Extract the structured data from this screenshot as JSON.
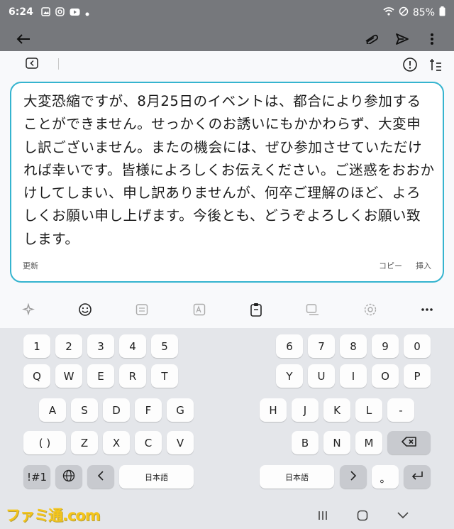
{
  "status": {
    "time": "6:24",
    "battery": "85%"
  },
  "compose": {
    "text": "大変恐縮ですが、8月25日のイベントは、都合により参加することができません。せっかくのお誘いにもかかわらず、大変申し訳ございません。またの機会には、ぜひ参加させていただければ幸いです。皆様によろしくお伝えください。ご迷惑をおおかけしてしまい、申し訳ありませんが、何卒ご理解のほど、よろしくお願い申し上げます。今後とも、どうぞよろしくお願い致します。",
    "refresh_label": "更新",
    "copy_label": "コピー",
    "insert_label": "挿入"
  },
  "keyboard": {
    "left_numbers": [
      "1",
      "2",
      "3",
      "4",
      "5"
    ],
    "right_numbers": [
      "6",
      "7",
      "8",
      "9",
      "0"
    ],
    "left_row1": [
      "Q",
      "W",
      "E",
      "R",
      "T"
    ],
    "right_row1": [
      "Y",
      "U",
      "I",
      "O",
      "P"
    ],
    "left_row2": [
      "A",
      "S",
      "D",
      "F",
      "G"
    ],
    "right_row2": [
      "H",
      "J",
      "K",
      "L",
      "-"
    ],
    "left_row3_first": "( )",
    "left_row3": [
      "Z",
      "X",
      "C",
      "V"
    ],
    "right_row3": [
      "B",
      "N",
      "M"
    ],
    "symbols_label": "!#1",
    "lang_label_left": "日本語",
    "lang_label_right": "日本語",
    "small_mark": "。"
  },
  "watermark": "ファミ通.com",
  "colors": {
    "accent": "#35b4cf",
    "header": "#76787c",
    "keyboard_bg": "#e4e6ea"
  },
  "icons": [
    "back-arrow-icon",
    "attach-icon",
    "send-icon",
    "more-vert-icon",
    "panel-left-icon",
    "info-circle-icon",
    "tune-icon",
    "sparkle-icon",
    "emoji-icon",
    "keyboard-mode-icon",
    "translate-icon",
    "clipboard-icon",
    "one-hand-icon",
    "settings-icon",
    "more-horiz-icon",
    "globe-icon",
    "chevron-left-icon",
    "chevron-right-icon",
    "backspace-icon",
    "enter-icon",
    "recent-apps-icon",
    "home-icon",
    "nav-back-icon"
  ]
}
